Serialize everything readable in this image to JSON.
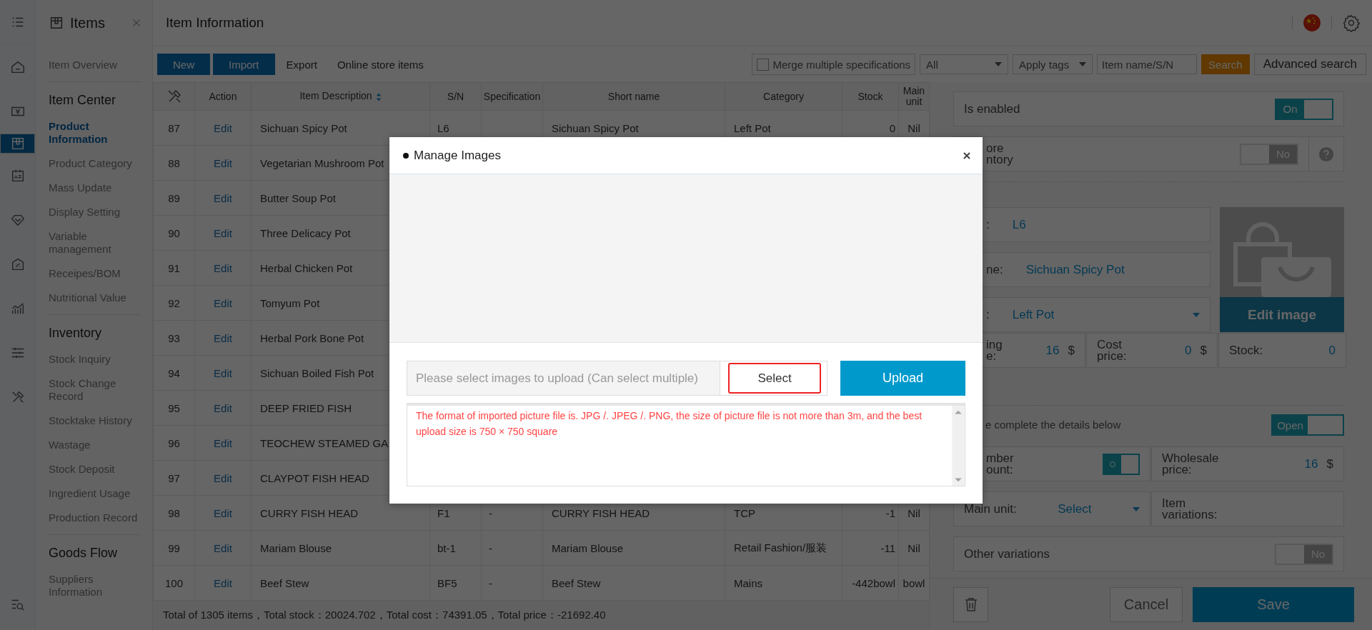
{
  "rail": {
    "icons": [
      {
        "kind": "menu",
        "selected": false
      },
      {
        "kind": "home",
        "selected": false
      },
      {
        "kind": "money",
        "selected": false
      },
      {
        "kind": "box",
        "selected": true
      },
      {
        "kind": "contact",
        "selected": false
      },
      {
        "kind": "diamond",
        "selected": false
      },
      {
        "kind": "discount",
        "selected": false
      },
      {
        "kind": "chart",
        "selected": false
      },
      {
        "kind": "sliders",
        "selected": false
      },
      {
        "kind": "tools",
        "selected": false
      }
    ],
    "bottom_icon": {
      "kind": "listsearch"
    }
  },
  "sidebar": {
    "title": "Items",
    "items": [
      {
        "kind": "link",
        "label": "Item Overview",
        "selected": false
      },
      {
        "kind": "section",
        "label": "Item Center"
      },
      {
        "kind": "link",
        "label": "Product Information",
        "selected": true
      },
      {
        "kind": "link",
        "label": "Product Category",
        "selected": false
      },
      {
        "kind": "link",
        "label": "Mass Update",
        "selected": false
      },
      {
        "kind": "link",
        "label": "Display Setting",
        "selected": false
      },
      {
        "kind": "link",
        "label": "Variable management",
        "selected": false
      },
      {
        "kind": "link",
        "label": "Receipes/BOM",
        "selected": false
      },
      {
        "kind": "link",
        "label": "Nutritional Value",
        "selected": false
      },
      {
        "kind": "section",
        "label": "Inventory"
      },
      {
        "kind": "link",
        "label": "Stock Inquiry",
        "selected": false
      },
      {
        "kind": "link",
        "label": "Stock Change Record",
        "selected": false
      },
      {
        "kind": "link",
        "label": "Stocktake History",
        "selected": false
      },
      {
        "kind": "link",
        "label": "Wastage",
        "selected": false
      },
      {
        "kind": "link",
        "label": "Stock Deposit",
        "selected": false
      },
      {
        "kind": "link",
        "label": "Ingredient Usage",
        "selected": false
      },
      {
        "kind": "link",
        "label": "Production Record",
        "selected": false
      },
      {
        "kind": "section",
        "label": "Goods Flow"
      },
      {
        "kind": "link",
        "label": "Suppliers Information",
        "selected": false
      }
    ]
  },
  "header": {
    "title": "Item Information"
  },
  "toolbar": {
    "buttons": [
      {
        "label": "New",
        "kind": "primary"
      },
      {
        "label": "Import",
        "kind": "primary"
      },
      {
        "label": "Export",
        "kind": "plain"
      },
      {
        "label": "Online store items",
        "kind": "plain"
      }
    ],
    "merge": {
      "label": "Merge multiple specifications",
      "checked": false
    },
    "filter": "All",
    "tags": "Apply tags",
    "search_placeholder": "Item name/S/N",
    "search_button": "Search",
    "advanced_button": "Advanced search"
  },
  "table": {
    "columns": [
      "Action",
      "Item Description",
      "S/N",
      "Specification",
      "Short name",
      "Category",
      "Stock",
      "Main unit"
    ],
    "rows": [
      {
        "no": "87",
        "action": "Edit",
        "description": "Sichuan Spicy Pot",
        "sn": "L6",
        "short_name": "Sichuan Spicy Pot",
        "category": "Left Pot",
        "stock": "0",
        "unit": "Nil"
      },
      {
        "no": "88",
        "action": "Edit",
        "description": "Vegetarian Mushroom Pot"
      },
      {
        "no": "89",
        "action": "Edit",
        "description": "Butter Soup Pot"
      },
      {
        "no": "90",
        "action": "Edit",
        "description": "Three Delicacy Pot"
      },
      {
        "no": "91",
        "action": "Edit",
        "description": "Herbal Chicken Pot"
      },
      {
        "no": "92",
        "action": "Edit",
        "description": "Tomyum Pot"
      },
      {
        "no": "93",
        "action": "Edit",
        "description": "Herbal Pork Bone Pot"
      },
      {
        "no": "94",
        "action": "Edit",
        "description": "Sichuan Boiled Fish Pot"
      },
      {
        "no": "95",
        "action": "Edit",
        "description": "DEEP FRIED FISH"
      },
      {
        "no": "96",
        "action": "Edit",
        "description": "TEOCHEW STEAMED GA"
      },
      {
        "no": "97",
        "action": "Edit",
        "description": "CLAYPOT FISH HEAD"
      },
      {
        "no": "98",
        "action": "Edit",
        "description": "CURRY FISH HEAD",
        "sn": "F1",
        "spec": "-",
        "short_name": "CURRY FISH HEAD",
        "category": "TCP",
        "stock": "-1",
        "unit": "Nil"
      },
      {
        "no": "99",
        "action": "Edit",
        "description": "Mariam Blouse",
        "sn": "bt-1",
        "spec": "-",
        "short_name": "Mariam Blouse",
        "category": "Retail Fashion/服装",
        "stock": "-11",
        "unit": "Nil"
      },
      {
        "no": "100",
        "action": "Edit",
        "description": "Beef Stew",
        "sn": "BF5",
        "spec": "-",
        "short_name": "Beef Stew",
        "category": "Mains",
        "stock": "-442bowl",
        "unit": "bowl"
      }
    ]
  },
  "summary": "Total of 1305 items，Total stock：20024.702，Total cost：74391.05，Total price：-21692.40",
  "detail": {
    "enabled": {
      "label": "Is enabled",
      "on": true,
      "toggle_label": "On"
    },
    "store_inventory": {
      "label": "ore\nntory",
      "on": false,
      "toggle_label": "No"
    },
    "sn": {
      "label": ":",
      "value": "L6"
    },
    "name": {
      "label": "ne:",
      "value": "Sichuan Spicy Pot"
    },
    "category": {
      "label": ":",
      "value": "Left Pot"
    },
    "image_button": "Edit image",
    "prices": [
      {
        "label": "ing\ne:",
        "value": "16",
        "unit": "$"
      },
      {
        "label": "Cost\nprice:",
        "value": "0",
        "unit": "$"
      },
      {
        "label": "Stock:",
        "value": "0"
      }
    ],
    "details": {
      "label": "e complete the details below",
      "on": true,
      "toggle_label": "Open"
    },
    "member_discount": {
      "label": "mber\nount:",
      "on": true
    },
    "wholesale": {
      "label": "Wholesale\nprice:",
      "value": "16",
      "unit": "$"
    },
    "main_unit": {
      "label": "Main unit:",
      "value": "Select"
    },
    "variations": {
      "label": "Item\nvariations:"
    },
    "other_variations": {
      "label": "Other variations",
      "on": false,
      "toggle_label": "No"
    },
    "cancel_button": "Cancel",
    "save_button": "Save"
  },
  "modal": {
    "title": "Manage Images",
    "file_placeholder": "Please select images to upload (Can select multiple)",
    "select_button": {
      "label": "Select",
      "highlighted": true
    },
    "upload_button": "Upload",
    "note": "The format of imported picture file is. JPG /. JPEG /. PNG, the size of picture file is not more than 3m, and the best upload size is 750 × 750 square"
  }
}
